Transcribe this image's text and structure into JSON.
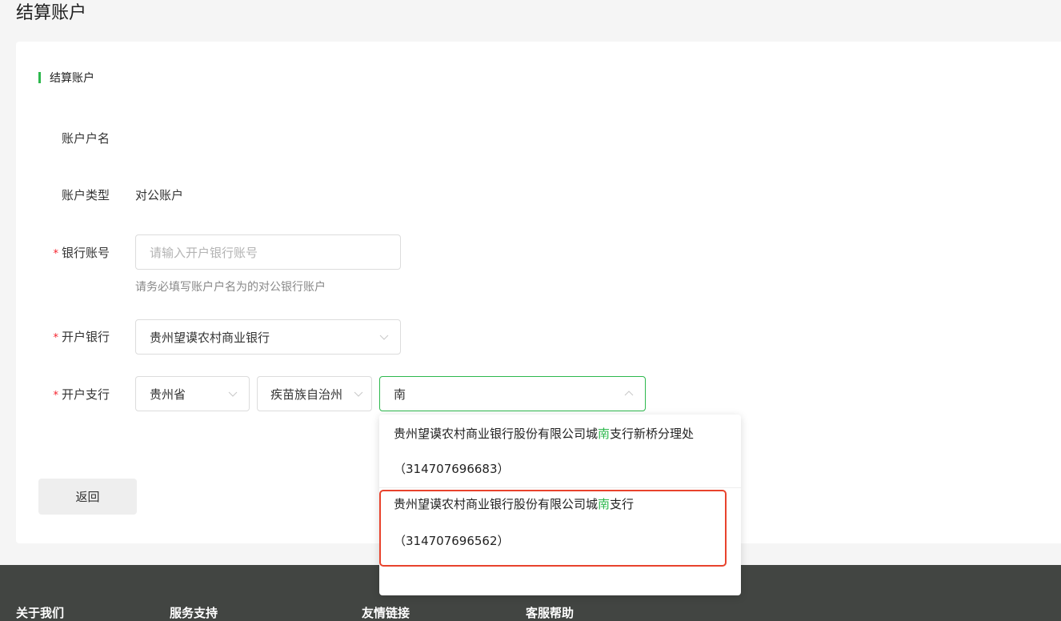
{
  "page": {
    "title": "结算账户"
  },
  "section": {
    "title": "结算账户"
  },
  "form": {
    "account_name": {
      "label": "账户户名",
      "value": ""
    },
    "account_type": {
      "label": "账户类型",
      "value": "对公账户"
    },
    "bank_account": {
      "label": "银行账号",
      "required": "*",
      "placeholder": "请输入开户银行账号",
      "hint": "请务必填写账户户名为的对公银行账户"
    },
    "bank": {
      "label": "开户银行",
      "required": "*",
      "value": "贵州望谟农村商业银行"
    },
    "branch": {
      "label": "开户支行",
      "required": "*",
      "province": "贵州省",
      "prefecture": "疾苗族自治州",
      "search": "南"
    }
  },
  "back_button": {
    "label": "返回"
  },
  "dropdown": {
    "options": [
      {
        "name_before": "贵州望谟农村商业银行股份有限公司城",
        "name_match": "南",
        "name_after": "支行新桥分理处",
        "code": "（314707696683）"
      },
      {
        "name_before": "贵州望谟农村商业银行股份有限公司城",
        "name_match": "南",
        "name_after": "支行",
        "code": "（314707696562）"
      }
    ]
  },
  "footer": {
    "links": [
      "关于我们",
      "服务支持",
      "友情链接",
      "客服帮助"
    ]
  },
  "colors": {
    "accent": "#2db84d",
    "required": "#f5222d",
    "highlight_box": "#e8432d",
    "footer_bg": "#424542"
  }
}
